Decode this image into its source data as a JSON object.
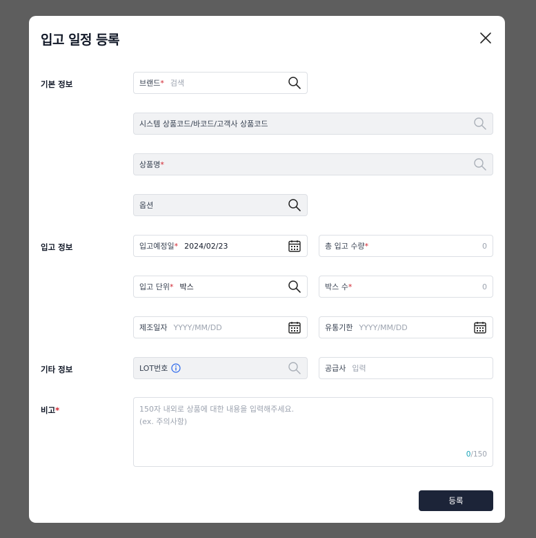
{
  "modal": {
    "title": "입고 일정 등록",
    "submit_label": "등록"
  },
  "sections": {
    "basic": "기본 정보",
    "inbound": "입고 정보",
    "other": "기타 정보",
    "note": "비고",
    "note_required": "*"
  },
  "fields": {
    "brand": {
      "label": "브랜드",
      "required": "*",
      "placeholder": "검색"
    },
    "system_code": {
      "label": "시스템 상품코드/바코드/고객사 상품코드"
    },
    "product_name": {
      "label": "상품명",
      "required": "*"
    },
    "option": {
      "label": "옵션"
    },
    "inbound_date": {
      "label": "입고예정일",
      "required": "*",
      "value": "2024/02/23"
    },
    "total_qty": {
      "label": "총 입고 수량",
      "required": "*",
      "value": "0"
    },
    "inbound_unit": {
      "label": "입고 단위",
      "required": "*",
      "value": "박스"
    },
    "box_count": {
      "label": "박스 수",
      "required": "*",
      "value": "0"
    },
    "mfg_date": {
      "label": "제조일자",
      "placeholder": "YYYY/MM/DD"
    },
    "expiry_date": {
      "label": "유통기한",
      "placeholder": "YYYY/MM/DD"
    },
    "lot_number": {
      "label": "LOT번호"
    },
    "supplier": {
      "label": "공급사",
      "placeholder": "입력"
    }
  },
  "note": {
    "placeholder_line1": "150자 내외로 상품에 대한 내용을 입력해주세요.",
    "placeholder_line2": "(ex. 주의사항)",
    "count_current": "0",
    "count_max": "/150"
  },
  "icons": {
    "close": "close-icon",
    "search": "search-icon",
    "calendar": "calendar-icon",
    "info": "info-icon"
  },
  "colors": {
    "overlay": "#5e5e5e",
    "primary_button": "#1c2438",
    "required": "#d1242f",
    "info": "#2563eb",
    "counter_current": "#16a3b8"
  }
}
